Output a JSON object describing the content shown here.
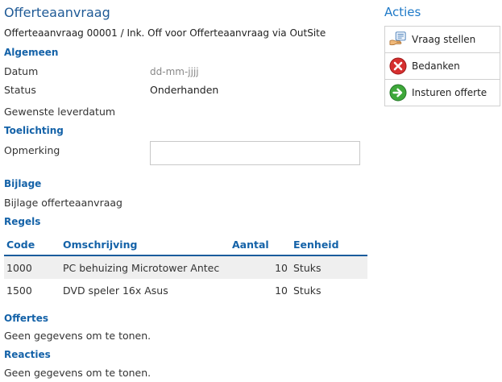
{
  "page": {
    "title": "Offerteaanvraag",
    "subtitle": "Offerteaanvraag 00001 / Ink. Off voor Offerteaanvraag via OutSite"
  },
  "general": {
    "heading": "Algemeen",
    "date_label": "Datum",
    "date_value": "dd-mm-jjjj",
    "status_label": "Status",
    "status_value": "Onderhanden",
    "delivery_label": "Gewenste leverdatum"
  },
  "notes": {
    "heading": "Toelichting",
    "remark_label": "Opmerking",
    "remark_value": ""
  },
  "attachment": {
    "heading": "Bijlage",
    "label": "Bijlage offerteaanvraag"
  },
  "lines": {
    "heading": "Regels",
    "columns": [
      "Code",
      "Omschrijving",
      "Aantal",
      "Eenheid"
    ],
    "rows": [
      [
        "1000",
        "PC behuizing Microtower Antec",
        "10",
        "Stuks"
      ],
      [
        "1500",
        "DVD speler 16x Asus",
        "10",
        "Stuks"
      ]
    ]
  },
  "quotes": {
    "heading": "Offertes",
    "empty": "Geen gegevens om te tonen."
  },
  "reactions": {
    "heading": "Reacties",
    "empty": "Geen gegevens om te tonen."
  },
  "actions": {
    "heading": "Acties",
    "items": [
      {
        "label": "Vraag stellen",
        "icon": "question-hand-icon"
      },
      {
        "label": "Bedanken",
        "icon": "red-x-circle-icon"
      },
      {
        "label": "Insturen offerte",
        "icon": "green-arrow-circle-icon"
      }
    ]
  },
  "colors": {
    "accent": "#1462a8",
    "heading": "#1f5a96",
    "row_alt": "#efefef"
  }
}
